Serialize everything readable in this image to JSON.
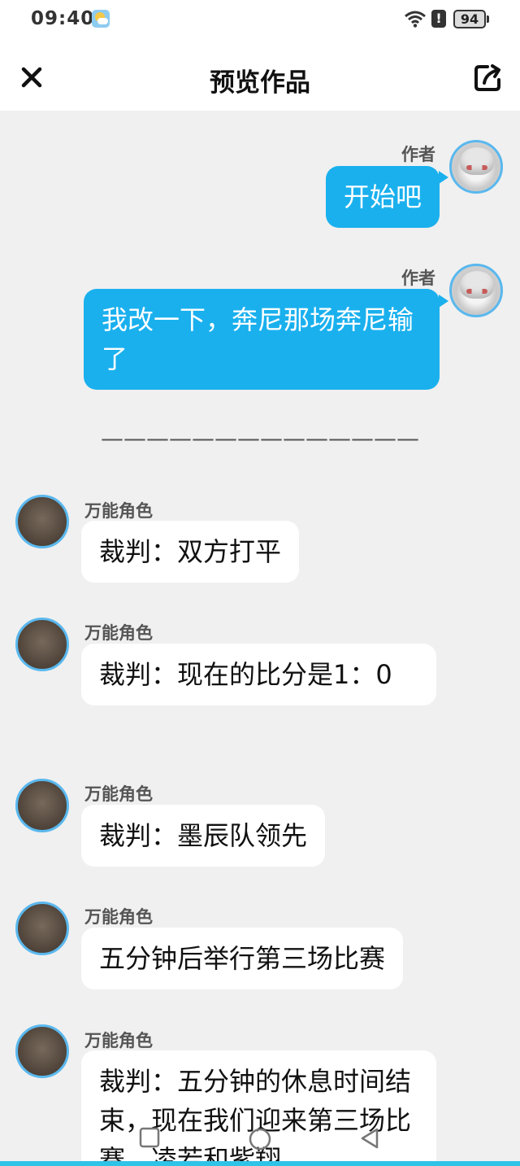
{
  "status_bar": {
    "time": "09:40",
    "battery": "94",
    "alert": "!",
    "icons": [
      "weather-icon",
      "wifi-icon",
      "alert-icon",
      "battery-icon"
    ]
  },
  "nav": {
    "title": "预览作品",
    "close_icon": "close-icon",
    "share_icon": "share-icon"
  },
  "messages_author": [
    {
      "name": "作者",
      "text": "开始吧"
    },
    {
      "name": "作者",
      "text": "我改一下，奔尼那场奔尼输了"
    }
  ],
  "divider": "——————————————",
  "messages_role": [
    {
      "name": "万能角色",
      "text": "裁判：双方打平"
    },
    {
      "name": "万能角色",
      "text": "裁判：现在的比分是1：0"
    },
    {
      "name": "万能角色",
      "text": "裁判：墨辰队领先"
    },
    {
      "name": "万能角色",
      "text": "五分钟后举行第三场比赛"
    },
    {
      "name": "万能角色",
      "text": "裁判：五分钟的休息时间结束，现在我们迎来第三场比赛，凌若和紫翔"
    }
  ],
  "colors": {
    "author_bubble": "#1ab0ee",
    "avatar_ring": "#5ab8ee",
    "background": "#f0f0f0"
  }
}
